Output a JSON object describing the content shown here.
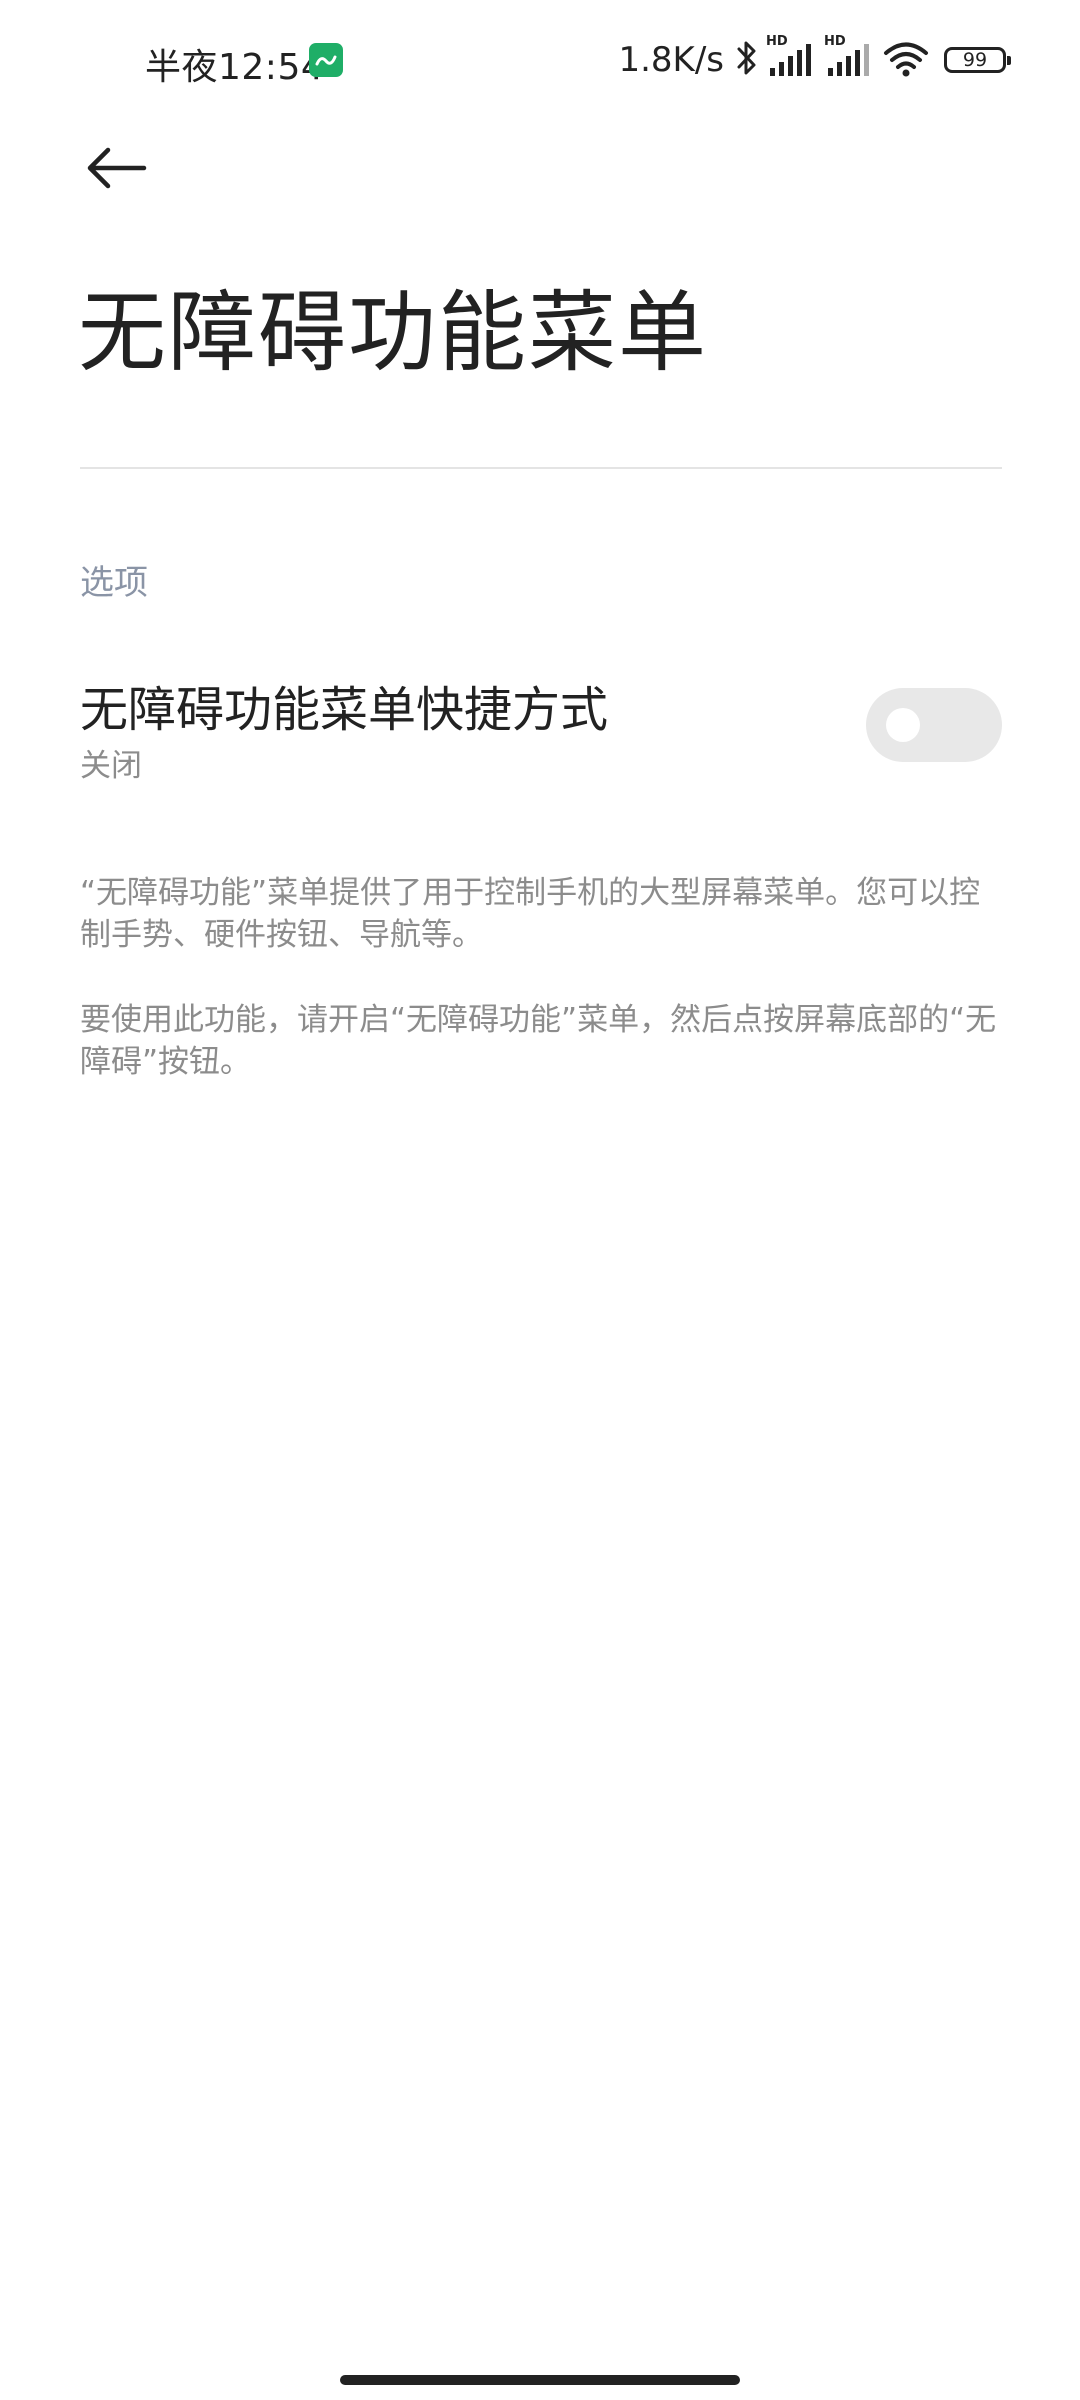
{
  "status_bar": {
    "time": "半夜12:54",
    "network_speed": "1.8K/s",
    "battery_level": "99",
    "signal_1_label": "HD",
    "signal_2_label": "HD",
    "icons": [
      "app-notification-icon",
      "bluetooth-icon",
      "signal-hd-icon",
      "signal-hd-icon",
      "wifi-icon",
      "battery-icon"
    ]
  },
  "header": {
    "back_icon": "back-arrow-icon",
    "title": "无障碍功能菜单"
  },
  "section": {
    "header": "选项"
  },
  "setting": {
    "title": "无障碍功能菜单快捷方式",
    "summary": "关闭",
    "toggle_on": false
  },
  "descriptions": [
    "“无障碍功能”菜单提供了用于控制手机的大型屏幕菜单。您可以控制手势、硬件按钮、导航等。",
    "要使用此功能，请开启“无障碍功能”菜单，然后点按屏幕底部的“无障碍”按钮。"
  ],
  "colors": {
    "text_primary": "#222222",
    "text_secondary": "#8c8c8c",
    "section_header": "#8a94a6",
    "toggle_track_off": "#e8e8e8",
    "app_icon": "#1fae67"
  }
}
